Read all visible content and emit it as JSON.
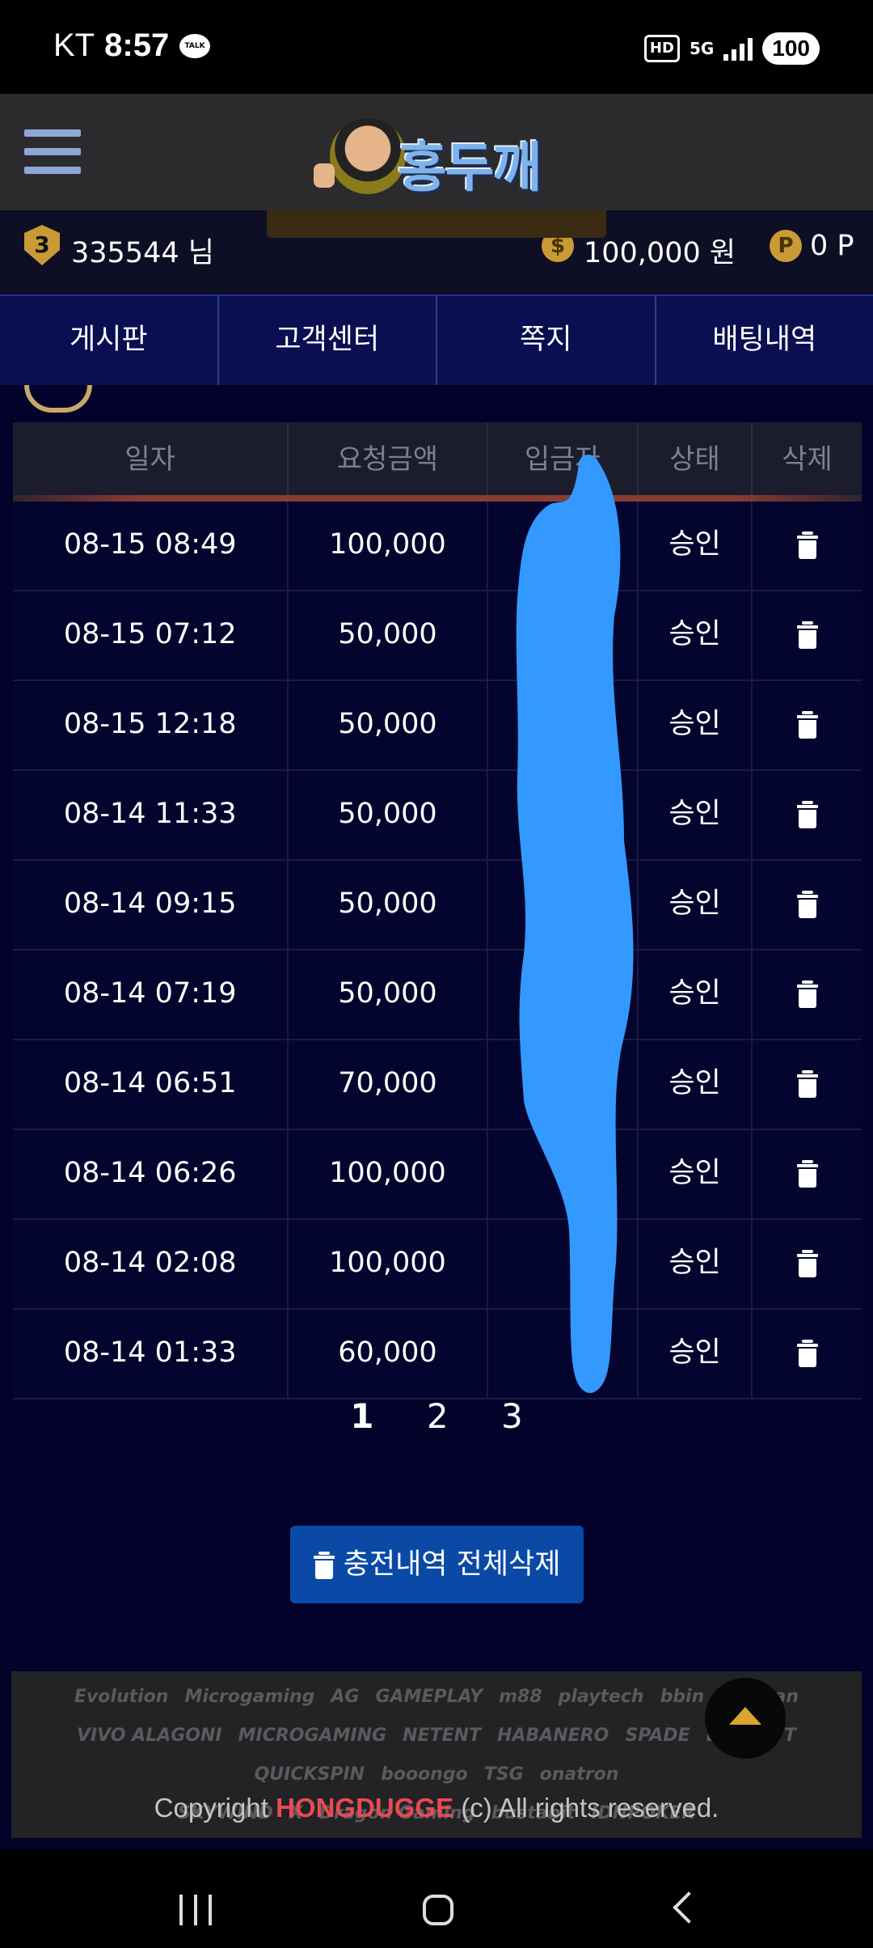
{
  "status_bar": {
    "carrier": "KT",
    "time": "8:57",
    "talk": "TALK",
    "hd": "HD",
    "network": "5G",
    "battery": "100"
  },
  "header": {
    "logo_text": "홍두깨"
  },
  "user": {
    "level": "3",
    "name": "335544 님",
    "balance": "100,000 원",
    "points": "0 P",
    "coin_symbol": "$",
    "point_symbol": "P"
  },
  "nav_tabs": [
    "게시판",
    "고객센터",
    "쪽지",
    "배팅내역"
  ],
  "table": {
    "headers": [
      "일자",
      "요청금액",
      "입금자",
      "상태",
      "삭제"
    ],
    "rows": [
      {
        "date": "08-15 08:49",
        "amount": "100,000",
        "depositor": "",
        "status": "승인"
      },
      {
        "date": "08-15 07:12",
        "amount": "50,000",
        "depositor": "",
        "status": "승인"
      },
      {
        "date": "08-15 12:18",
        "amount": "50,000",
        "depositor": "",
        "status": "승인"
      },
      {
        "date": "08-14 11:33",
        "amount": "50,000",
        "depositor": "",
        "status": "승인"
      },
      {
        "date": "08-14 09:15",
        "amount": "50,000",
        "depositor": "",
        "status": "승인"
      },
      {
        "date": "08-14 07:19",
        "amount": "50,000",
        "depositor": "",
        "status": "승인"
      },
      {
        "date": "08-14 06:51",
        "amount": "70,000",
        "depositor": "",
        "status": "승인"
      },
      {
        "date": "08-14 06:26",
        "amount": "100,000",
        "depositor": "",
        "status": "승인"
      },
      {
        "date": "08-14 02:08",
        "amount": "100,000",
        "depositor": "",
        "status": "승인"
      },
      {
        "date": "08-14 01:33",
        "amount": "60,000",
        "depositor": "",
        "status": "승인"
      }
    ]
  },
  "pagination": {
    "pages": [
      "1",
      "2",
      "3"
    ],
    "current": "1"
  },
  "delete_all_label": "충전내역 전체삭제",
  "footer": {
    "vendors_row1": [
      "Evolution",
      "Microgaming",
      "AG",
      "GAMEPLAY",
      "m88",
      "playtech",
      "bbin",
      "TaiShan"
    ],
    "vendors_row2": [
      "VIVO ALAGONI",
      "MICROGAMING",
      "NETENT",
      "HABANERO",
      "SPADE",
      "BETSOFT",
      "QUICKSPIN",
      "booongo",
      "TSG",
      "onatron"
    ],
    "vendors_row3": [
      "SKYWIND",
      "X",
      "Dragon Gaming",
      "bustabit",
      "IDNPOKER"
    ],
    "copyright_prefix": "Copyright ",
    "copyright_brand": "HONGDUGGE",
    "copyright_suffix": " (c) All rights reserved."
  },
  "colors": {
    "accent_blue": "#0a4aa6",
    "nav_bg": "#0a0f52",
    "brand_red": "#e84a54",
    "gold": "#c99a36",
    "scribble": "#3399ff"
  }
}
